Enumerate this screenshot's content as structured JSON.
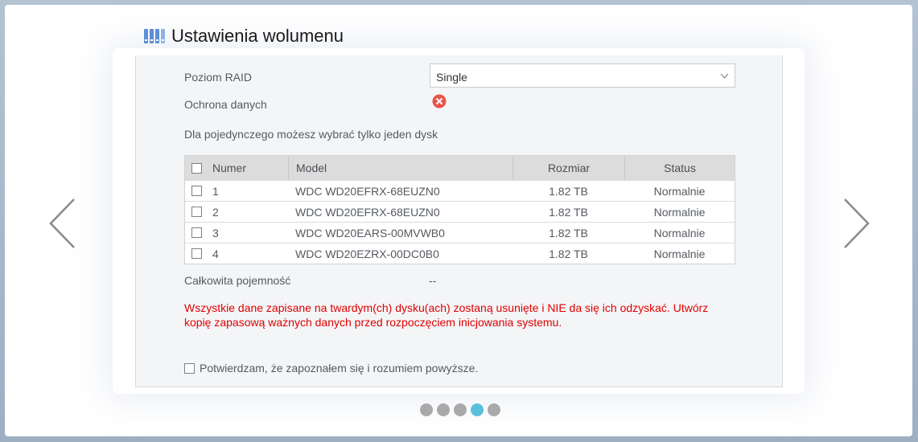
{
  "header": {
    "title": "Ustawienia wolumenu",
    "icon": "drive-array-icon"
  },
  "form": {
    "raid_label": "Poziom RAID",
    "raid_value": "Single",
    "protection_label": "Ochrona danych",
    "protection_status": "error-icon",
    "hint": "Dla pojedynczego możesz wybrać tylko jeden dysk"
  },
  "table": {
    "columns": [
      "Numer",
      "Model",
      "Rozmiar",
      "Status"
    ],
    "rows": [
      {
        "num": "1",
        "model": "WDC WD20EFRX-68EUZN0",
        "size": "1.82 TB",
        "status": "Normalnie"
      },
      {
        "num": "2",
        "model": "WDC WD20EFRX-68EUZN0",
        "size": "1.82 TB",
        "status": "Normalnie"
      },
      {
        "num": "3",
        "model": "WDC WD20EARS-00MVWB0",
        "size": "1.82 TB",
        "status": "Normalnie"
      },
      {
        "num": "4",
        "model": "WDC WD20EZRX-00DC0B0",
        "size": "1.82 TB",
        "status": "Normalnie"
      }
    ]
  },
  "capacity": {
    "label": "Całkowita pojemność",
    "value": "--"
  },
  "warning": "Wszystkie dane zapisane na twardym(ch) dysku(ach) zostaną usunięte i NIE da się ich odzyskać. Utwórz kopię zapasową ważnych danych przed rozpoczęciem inicjowania systemu.",
  "confirm_label": "Potwierdzam, że zapoznałem się i rozumiem powyższe.",
  "pager": {
    "total": 5,
    "current": 4
  },
  "colors": {
    "warning": "#e00000",
    "active_dot": "#5bc0de",
    "error_icon": "#e8534a"
  }
}
